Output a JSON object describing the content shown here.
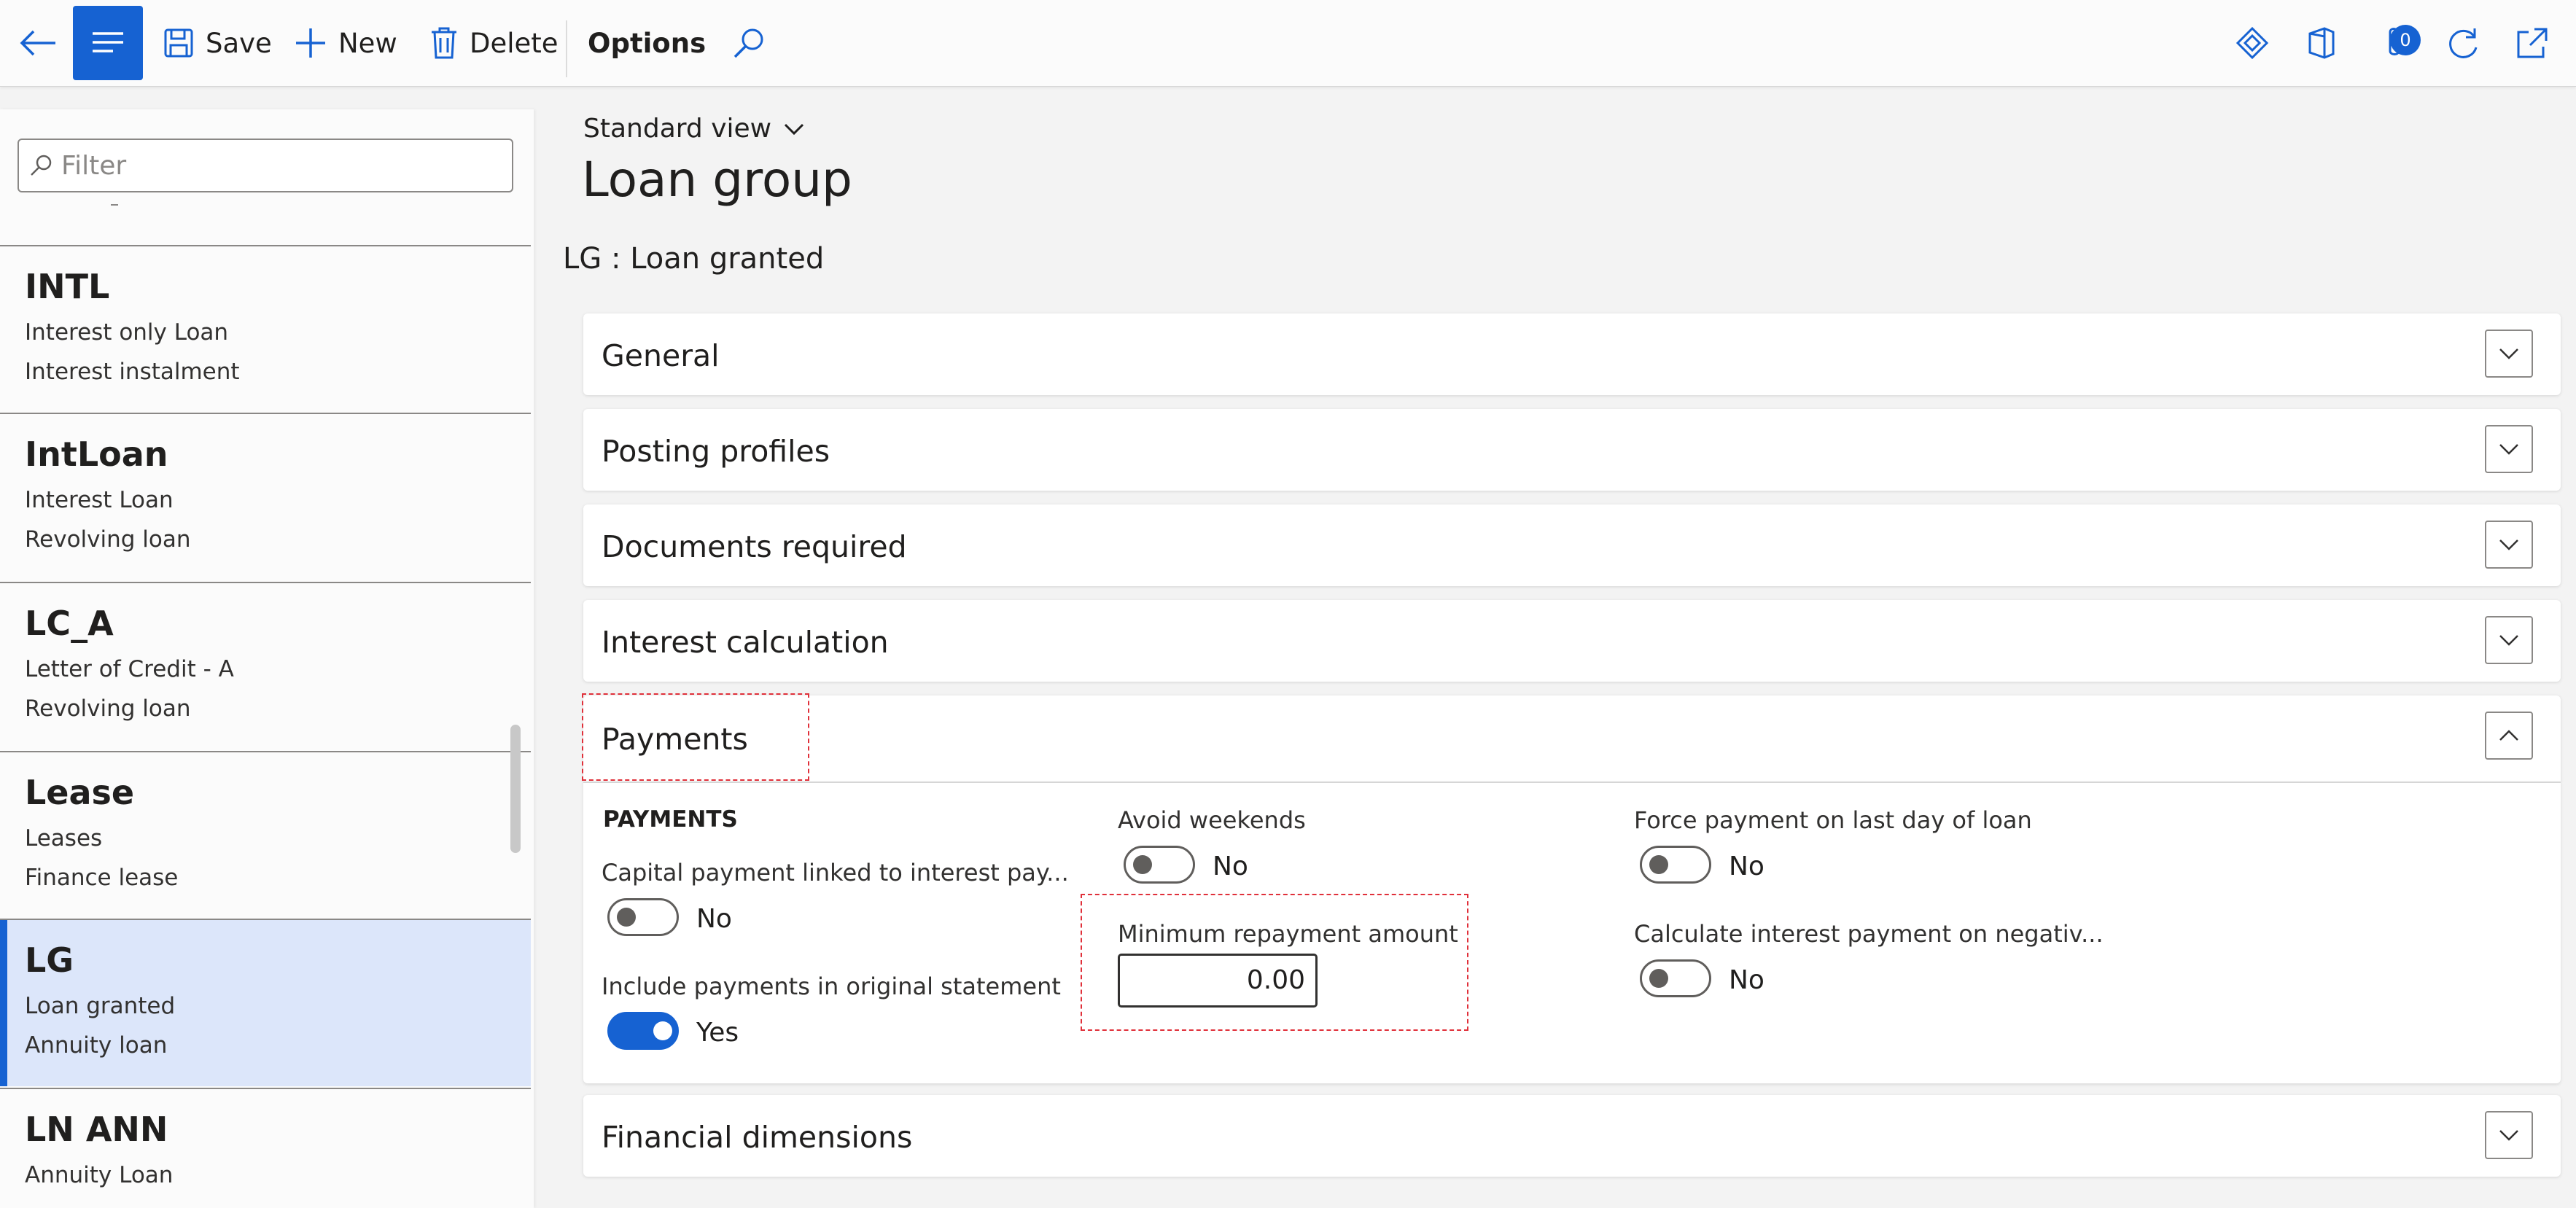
{
  "toolbar": {
    "save_label": "Save",
    "new_label": "New",
    "delete_label": "Delete",
    "options_label": "Options",
    "attachments_count": "0"
  },
  "list": {
    "filter_placeholder": "Filter",
    "records": [
      {
        "id": "INTL",
        "line1": "Interest only Loan",
        "line2": "Interest instalment",
        "selected": false
      },
      {
        "id": "IntLoan",
        "line1": "Interest Loan",
        "line2": "Revolving loan",
        "selected": false
      },
      {
        "id": "LC_A",
        "line1": "Letter of Credit - A",
        "line2": "Revolving loan",
        "selected": false
      },
      {
        "id": "Lease",
        "line1": "Leases",
        "line2": "Finance lease",
        "selected": false
      },
      {
        "id": "LG",
        "line1": "Loan granted",
        "line2": "Annuity loan",
        "selected": true
      },
      {
        "id": "LN ANN",
        "line1": "Annuity Loan",
        "line2": "",
        "selected": false
      }
    ]
  },
  "main": {
    "view_selector": "Standard view",
    "page_title": "Loan group",
    "record_title": "LG : Loan granted",
    "sections": [
      {
        "label": "General",
        "expanded": false
      },
      {
        "label": "Posting profiles",
        "expanded": false
      },
      {
        "label": "Documents required",
        "expanded": false
      },
      {
        "label": "Interest calculation",
        "expanded": false
      },
      {
        "label": "Payments",
        "expanded": true
      },
      {
        "label": "Financial dimensions",
        "expanded": false
      }
    ]
  },
  "payments": {
    "group_label": "PAYMENTS",
    "capital_linked": {
      "label": "Capital payment linked to interest pay...",
      "value": "No",
      "on": false
    },
    "include_original": {
      "label": "Include payments in original statement",
      "value": "Yes",
      "on": true
    },
    "avoid_weekends": {
      "label": "Avoid weekends",
      "value": "No",
      "on": false
    },
    "min_repayment": {
      "label": "Minimum repayment amount",
      "value": "0.00"
    },
    "force_last_day": {
      "label": "Force payment on last day of loan",
      "value": "No",
      "on": false
    },
    "calc_interest_negative": {
      "label": "Calculate interest payment on negativ...",
      "value": "No",
      "on": false
    }
  },
  "colors": {
    "accent": "#1662d2",
    "highlight_box": "#e0303a",
    "selected_row": "#dce6fa"
  }
}
